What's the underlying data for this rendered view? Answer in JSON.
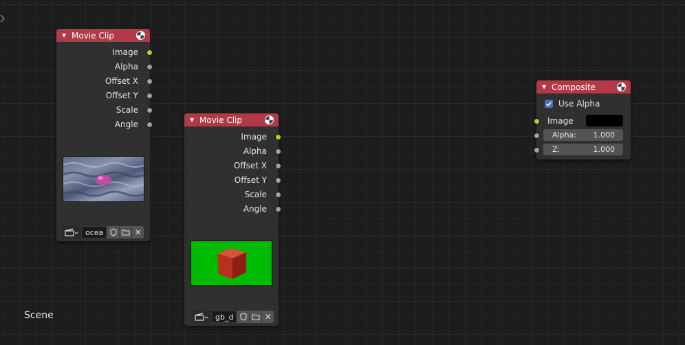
{
  "editor": {
    "scene_label": "Scene"
  },
  "nodes": {
    "clip1": {
      "title": "Movie Clip",
      "outputs": [
        "Image",
        "Alpha",
        "Offset X",
        "Offset Y",
        "Scale",
        "Angle"
      ],
      "clip_name": "ocea"
    },
    "clip2": {
      "title": "Movie Clip",
      "outputs": [
        "Image",
        "Alpha",
        "Offset X",
        "Offset Y",
        "Scale",
        "Angle"
      ],
      "clip_name": "gb_d"
    },
    "composite": {
      "title": "Composite",
      "use_alpha_label": "Use Alpha",
      "use_alpha_checked": true,
      "image_label": "Image",
      "alpha_label": "Alpha:",
      "alpha_value": "1.000",
      "z_label": "Z:",
      "z_value": "1.000"
    }
  },
  "icons": {
    "collapse": "triangle-down-icon",
    "render": "render-checker-icon",
    "clip": "clapperboard-icon",
    "fake_user": "shield-icon",
    "open": "folder-icon",
    "unlink": "close-icon"
  },
  "colors": {
    "header": "#b23a48",
    "socket_color": "#c7c729",
    "socket_value": "#a1a1a1",
    "accent": "#4772b3",
    "preview2_bg": "#00bb00"
  }
}
